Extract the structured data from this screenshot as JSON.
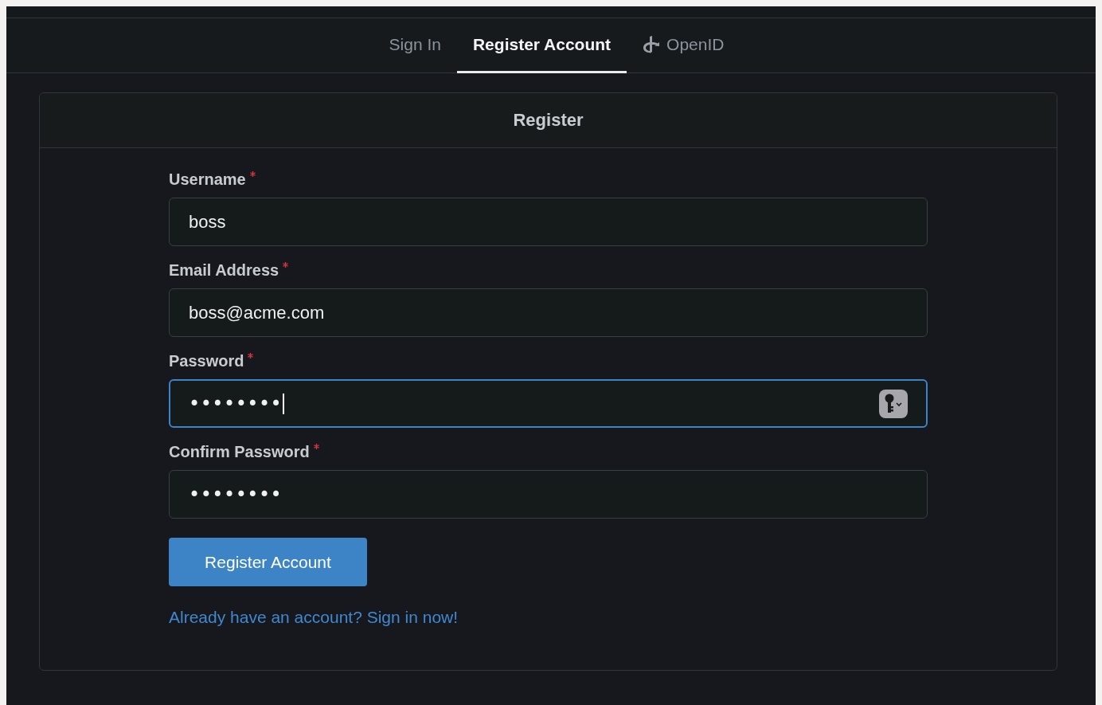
{
  "tabs": [
    {
      "label": "Sign In",
      "selected": false,
      "kind": "plain"
    },
    {
      "label": "Register Account",
      "selected": true,
      "kind": "plain"
    },
    {
      "label": "OpenID",
      "selected": false,
      "kind": "provider"
    }
  ],
  "card": {
    "title": "Register",
    "fields": [
      {
        "label": "Username",
        "kind": "text",
        "required": true,
        "value": "boss",
        "focused": false,
        "key_button": false,
        "caret": false
      },
      {
        "label": "Email Address",
        "kind": "text",
        "required": true,
        "value": "boss@acme.com",
        "focused": false,
        "key_button": false,
        "caret": false
      },
      {
        "label": "Password",
        "kind": "password",
        "required": true,
        "value": "••••••••",
        "focused": true,
        "key_button": true,
        "caret": true
      },
      {
        "label": "Confirm Password",
        "kind": "password",
        "required": true,
        "value": "••••••••",
        "focused": false,
        "key_button": false,
        "caret": false
      }
    ],
    "submit_button": "Register Account",
    "signin_link": "Already have an account? Sign in now!"
  }
}
